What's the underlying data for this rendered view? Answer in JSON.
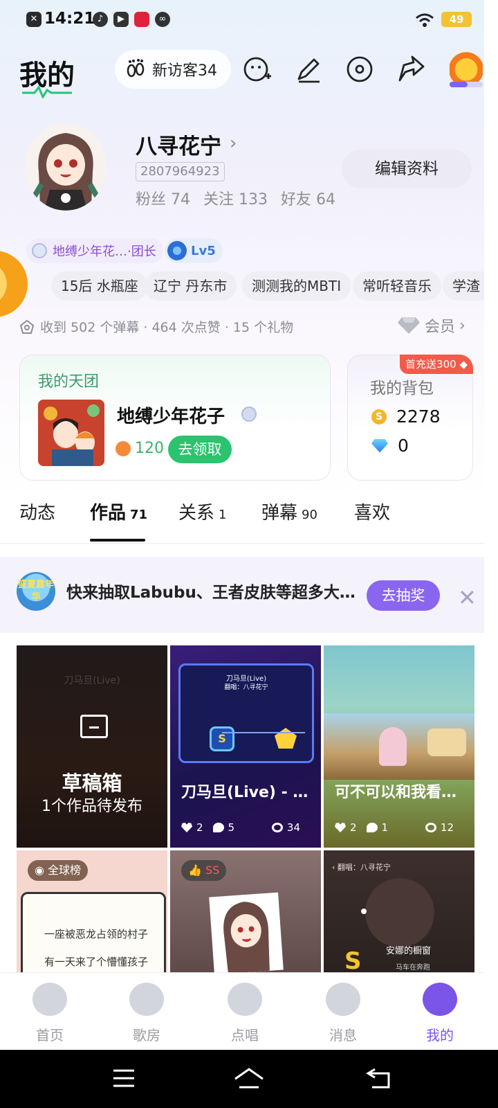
{
  "status_bar": {
    "time": "14:21",
    "battery": "49"
  },
  "header": {
    "title": "我的",
    "visitors": "新访客34"
  },
  "profile": {
    "name": "八寻花宁",
    "uid": "2807964923",
    "stats": [
      "粉丝 74",
      "关注 133",
      "好友 64"
    ],
    "edit_button": "编辑资料"
  },
  "badges": {
    "team": "地缚少年花…·团长",
    "level": "Lv5"
  },
  "tags": [
    "15后 水瓶座",
    "辽宁 丹东市",
    "测测我的MBTI",
    "常听轻音乐",
    "学渣"
  ],
  "received": "收到 502 个弹幕 · 464 次点赞 · 15 个礼物",
  "vip": "会员",
  "team_card": {
    "label": "我的天团",
    "name": "地缚少年花子",
    "points": "120",
    "claim": "去领取"
  },
  "bag_card": {
    "promo": "首充送300",
    "label": "我的背包",
    "coins": "2278",
    "gems": "0"
  },
  "tabs": [
    {
      "label": "动态",
      "count": ""
    },
    {
      "label": "作品",
      "count": "71"
    },
    {
      "label": "关系",
      "count": "1"
    },
    {
      "label": "弹幕",
      "count": "90"
    },
    {
      "label": "喜欢",
      "count": ""
    }
  ],
  "banner": {
    "logo": "盛夏嘉年华",
    "text": "快来抽取Labubu、王者皮肤等超多大…",
    "button": "去抽奖"
  },
  "works": {
    "draft": {
      "title": "草稿箱",
      "subtitle": "1个作品待发布",
      "bg_text": "刀马旦(Live)"
    },
    "item1": {
      "title": "刀马旦(Live) - …",
      "likes": "2",
      "comments": "5",
      "plays": "34",
      "screen_title": "刀马旦(Live)",
      "screen_sub": "翻唱：八寻花宁"
    },
    "item2": {
      "title": "可不可以和我看…",
      "likes": "2",
      "comments": "1",
      "plays": "12"
    },
    "item3": {
      "badge": "全球榜",
      "line1": "一座被恶龙占领的村子",
      "line2": "有一天来了个懵懂孩子"
    },
    "item4": {
      "badge": "SS"
    },
    "item5": {
      "header": "翻唱：八寻花宁",
      "song": "安娜的橱窗",
      "sub": "马车在奔跑"
    }
  },
  "bottom_nav": [
    "首页",
    "歌房",
    "点唱",
    "消息",
    "我的"
  ]
}
